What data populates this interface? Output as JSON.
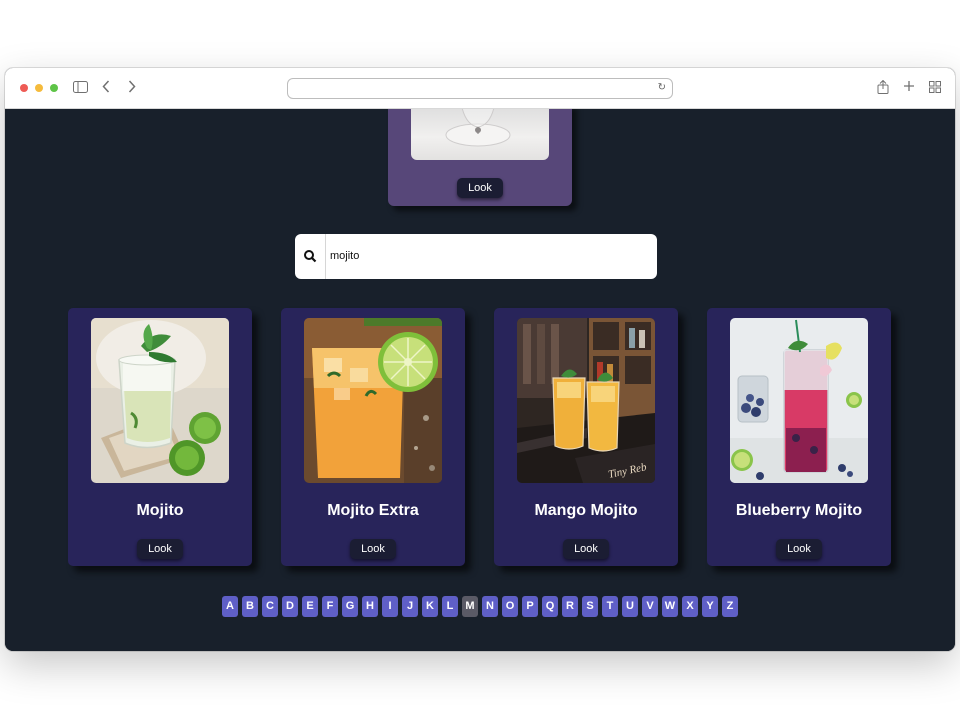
{
  "browser": {
    "url": ""
  },
  "featured": {
    "look_label": "Look"
  },
  "search": {
    "value": "mojito",
    "placeholder": ""
  },
  "cards": [
    {
      "title": "Mojito",
      "look_label": "Look"
    },
    {
      "title": "Mojito Extra",
      "look_label": "Look"
    },
    {
      "title": "Mango Mojito",
      "look_label": "Look"
    },
    {
      "title": "Blueberry Mojito",
      "look_label": "Look"
    }
  ],
  "alphabet": {
    "letters": [
      "A",
      "B",
      "C",
      "D",
      "E",
      "F",
      "G",
      "H",
      "I",
      "J",
      "K",
      "L",
      "M",
      "N",
      "O",
      "P",
      "Q",
      "R",
      "S",
      "T",
      "U",
      "V",
      "W",
      "X",
      "Y",
      "Z"
    ],
    "active": "M"
  },
  "colors": {
    "page_bg": "#18202b",
    "card_bg": "#28245a",
    "featured_bg": "#574779",
    "letter_bg": "#5f5fc7",
    "letter_active_bg": "#5a5a66",
    "button_bg": "#1b1d33"
  }
}
